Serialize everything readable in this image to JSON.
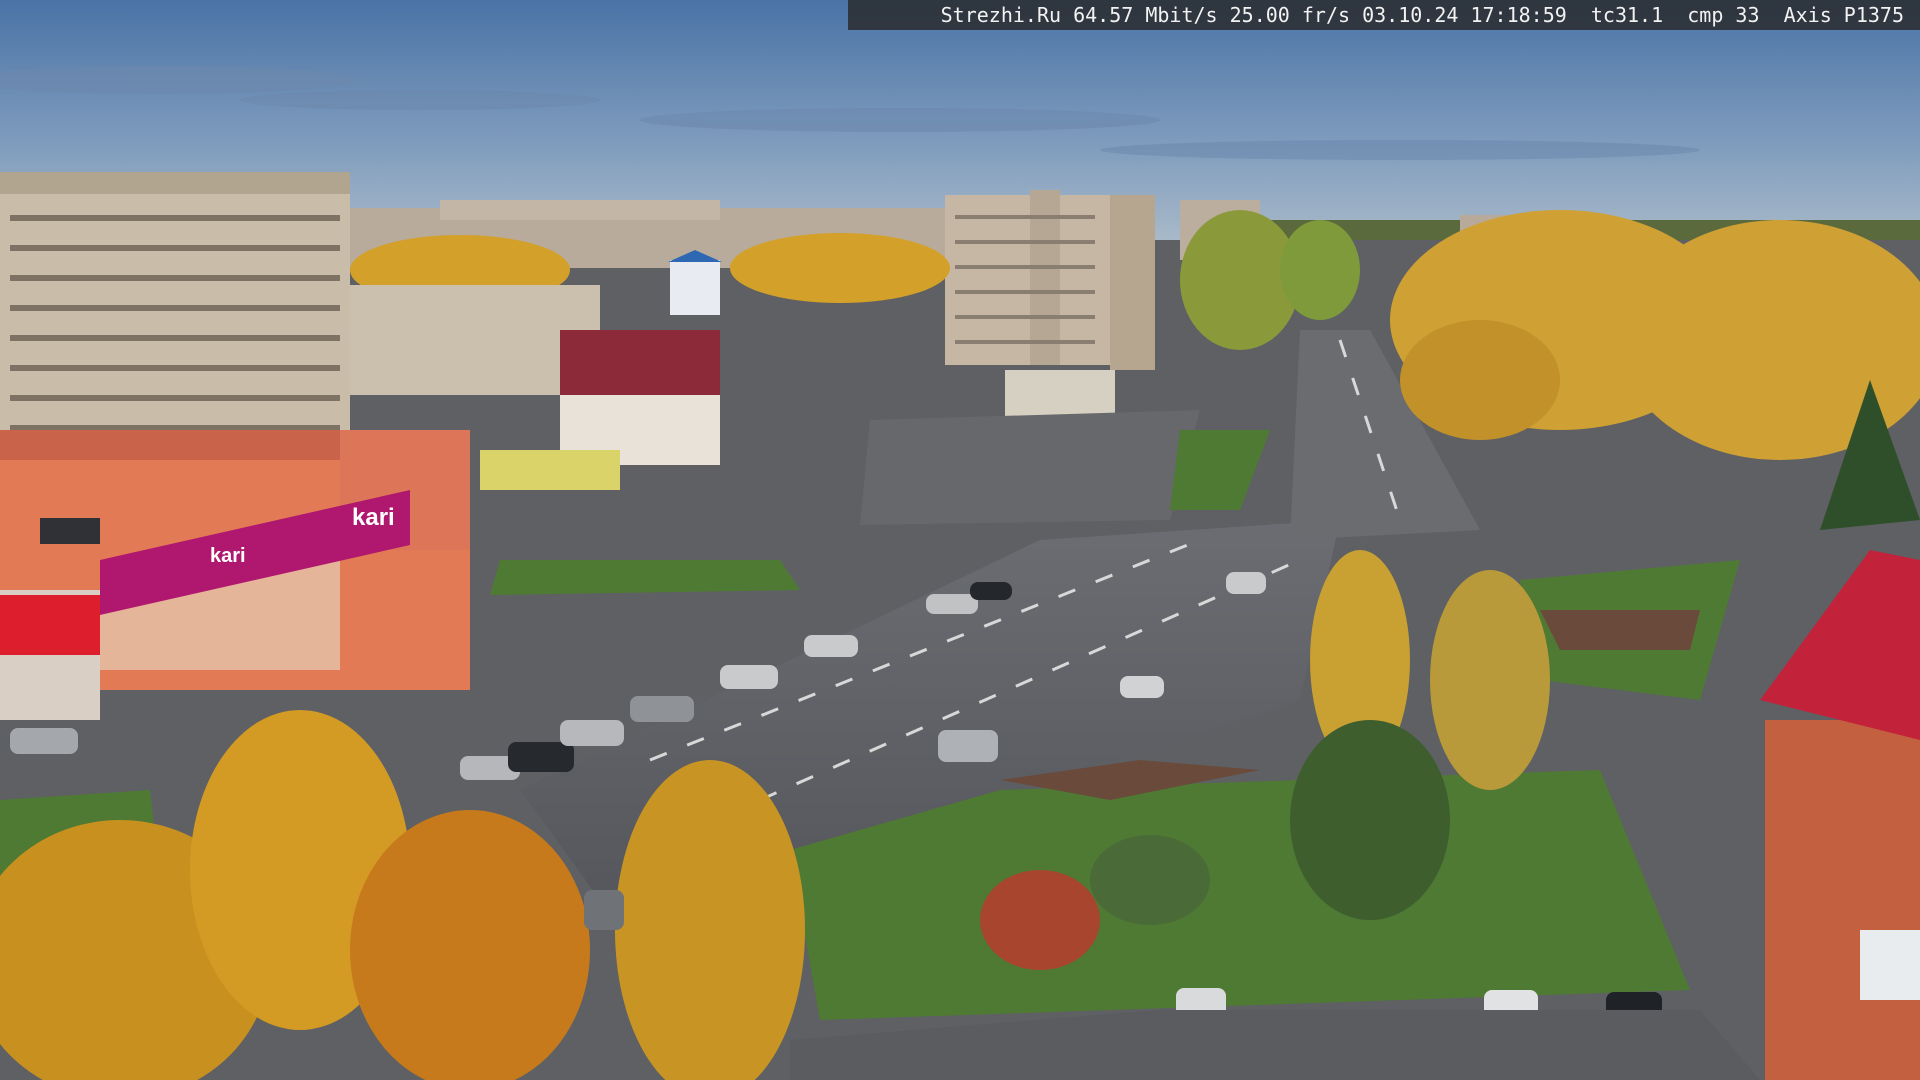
{
  "overlay": {
    "site": "Strezhi.Ru",
    "bitrate": "64.57 Mbit/s",
    "framerate": "25.00 fr/s",
    "date": "03.10.24",
    "time": "17:18:59",
    "tc": "tc31.1",
    "cmp": "cmp 33",
    "camera": "Axis P1375"
  },
  "signs": {
    "store_main": "kari",
    "store_side": "kari"
  },
  "palette": {
    "sky_top": "#4f78a8",
    "sky_bottom": "#9fb6cc",
    "foliage": "#d3a02a",
    "asphalt": "#5d5f63",
    "grass": "#4f7a33",
    "store_magenta": "#b0186f",
    "roof_red": "#c2233a"
  }
}
